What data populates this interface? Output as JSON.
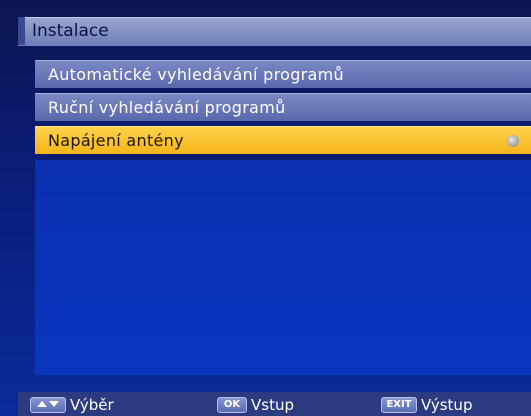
{
  "header": {
    "title": "Instalace"
  },
  "menu": {
    "items": [
      {
        "label": "Automatické vyhledávání programů",
        "selected": false
      },
      {
        "label": "Ruční vyhledávání programů",
        "selected": false
      },
      {
        "label": "Napájení antény",
        "selected": true
      }
    ]
  },
  "footer": {
    "select": {
      "key": "▲▼",
      "label": "Výběr"
    },
    "enter": {
      "key": "OK",
      "label": "Vstup"
    },
    "exit": {
      "key": "EXIT",
      "label": "Výstup"
    }
  },
  "colors": {
    "background": "#0a2a9a",
    "menu_item": "#6a77b8",
    "selected": "#f6c02a",
    "header": "#8893c8"
  },
  "icons": [
    "navigate-up-down-icon",
    "ok-key-icon",
    "exit-key-icon",
    "submenu-arrow-icon"
  ]
}
